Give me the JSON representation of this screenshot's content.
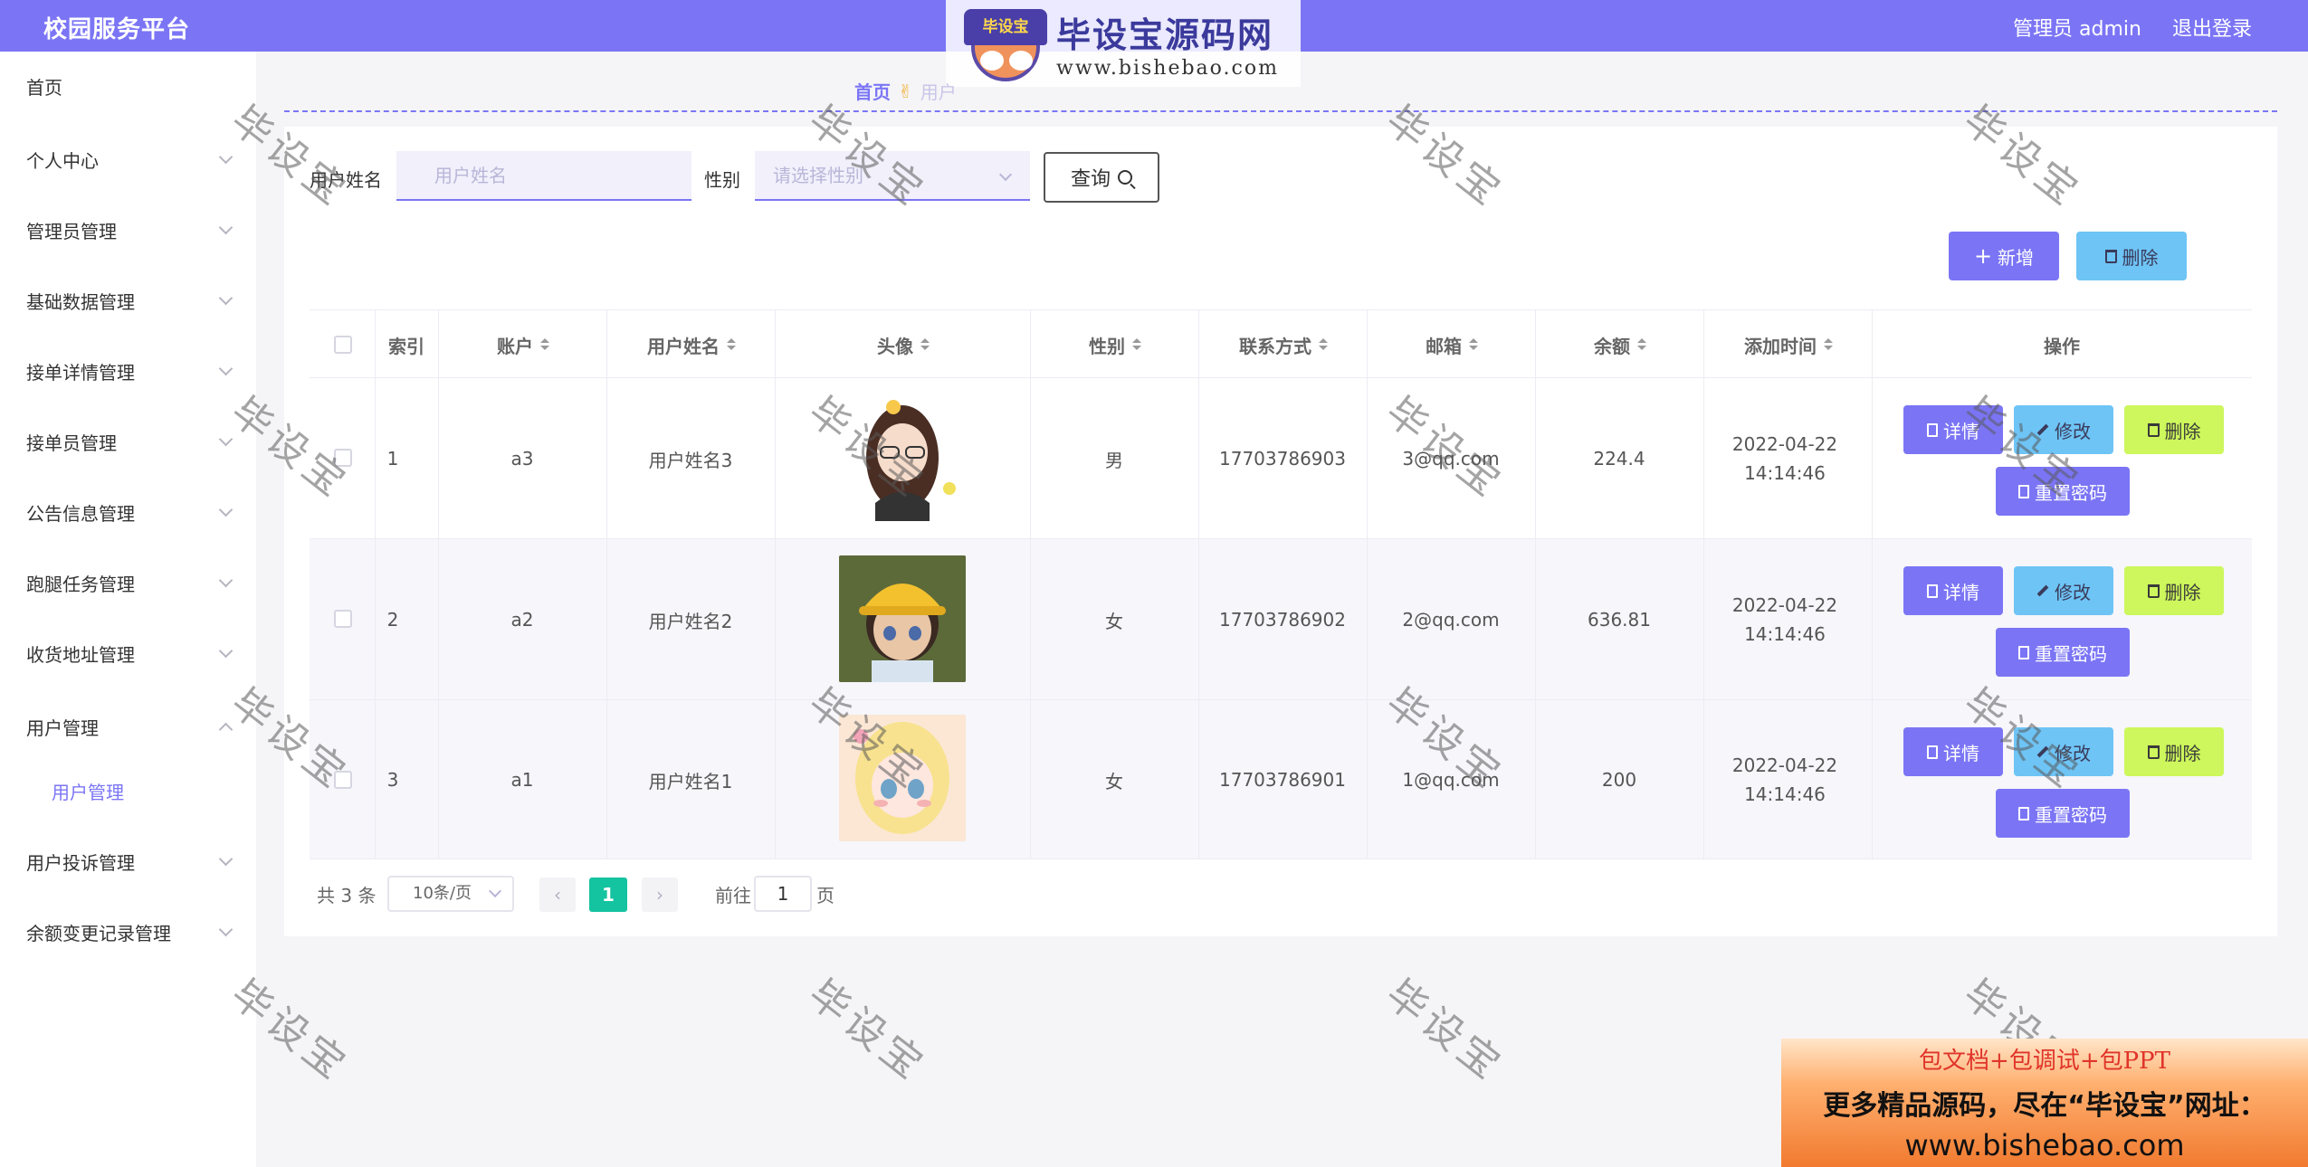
{
  "header": {
    "title": "校园服务平台",
    "admin_label": "管理员 admin",
    "logout_label": "退出登录"
  },
  "logo": {
    "badge": "毕设宝",
    "name": "毕设宝源码网",
    "url": "www.bishebao.com"
  },
  "sidebar": {
    "items": [
      {
        "label": "首页"
      },
      {
        "label": "个人中心"
      },
      {
        "label": "管理员管理"
      },
      {
        "label": "基础数据管理"
      },
      {
        "label": "接单详情管理"
      },
      {
        "label": "接单员管理"
      },
      {
        "label": "公告信息管理"
      },
      {
        "label": "跑腿任务管理"
      },
      {
        "label": "收货地址管理"
      },
      {
        "label": "用户管理"
      },
      {
        "label": "用户管理"
      },
      {
        "label": "用户投诉管理"
      },
      {
        "label": "余额变更记录管理"
      }
    ]
  },
  "breadcrumb": {
    "home": "首页",
    "current": "用户"
  },
  "search": {
    "name_label": "用户姓名",
    "name_placeholder": "用户姓名",
    "gender_label": "性别",
    "gender_placeholder": "请选择性别",
    "query_label": "查询"
  },
  "actions": {
    "add_label": "新增",
    "delete_label": "删除"
  },
  "table": {
    "headers": [
      "索引",
      "账户",
      "用户姓名",
      "头像",
      "性别",
      "联系方式",
      "邮箱",
      "余额",
      "添加时间",
      "操作"
    ],
    "rows": [
      {
        "index": "1",
        "account": "a3",
        "name": "用户姓名3",
        "gender": "男",
        "phone": "17703786903",
        "email": "3@qq.com",
        "balance": "224.4",
        "time": "2022-04-22 14:14:46"
      },
      {
        "index": "2",
        "account": "a2",
        "name": "用户姓名2",
        "gender": "女",
        "phone": "17703786902",
        "email": "2@qq.com",
        "balance": "636.81",
        "time": "2022-04-22 14:14:46"
      },
      {
        "index": "3",
        "account": "a1",
        "name": "用户姓名1",
        "gender": "女",
        "phone": "17703786901",
        "email": "1@qq.com",
        "balance": "200",
        "time": "2022-04-22 14:14:46"
      }
    ],
    "row_actions": {
      "detail": "详情",
      "edit": "修改",
      "delete": "删除",
      "reset": "重置密码"
    }
  },
  "pagination": {
    "total": "共 3 条",
    "page_size": "10条/页",
    "current_page": "1",
    "goto_prefix": "前往",
    "goto_value": "1",
    "goto_suffix": "页"
  },
  "watermark": "毕设宝",
  "ad": {
    "line1": "包文档+包调试+包PPT",
    "line2": "更多精品源码，尽在“毕设宝”网址：",
    "line3": "www.bishebao.com"
  },
  "colors": {
    "primary": "#7b75f5",
    "sky": "#6ec4f5",
    "lime": "#cdf75c",
    "active_page": "#14c3a0"
  }
}
